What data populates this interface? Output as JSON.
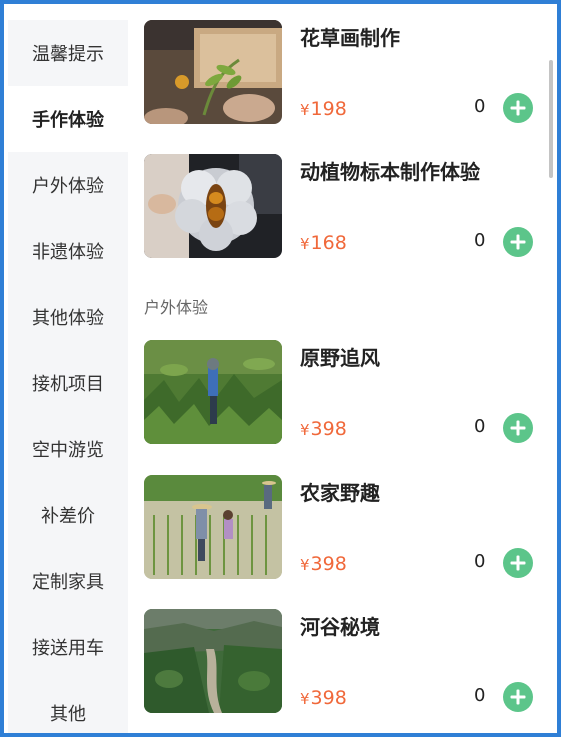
{
  "sidebar": {
    "items": [
      {
        "label": "温馨提示"
      },
      {
        "label": "手作体验",
        "active": true
      },
      {
        "label": "户外体验"
      },
      {
        "label": "非遗体验"
      },
      {
        "label": "其他体验"
      },
      {
        "label": "接机项目"
      },
      {
        "label": "空中游览"
      },
      {
        "label": "补差价"
      },
      {
        "label": "定制家具"
      },
      {
        "label": "接送用车"
      },
      {
        "label": "其他"
      }
    ]
  },
  "currency": "¥",
  "handcraft_items": [
    {
      "name": "花草画制作",
      "price": "198",
      "quantity": "0",
      "image": "pressed-flower-craft-photo"
    },
    {
      "name": "动植物标本制作体验",
      "price": "168",
      "quantity": "0",
      "image": "insect-specimen-photo"
    }
  ],
  "outdoor_section": {
    "title": "户外体验",
    "items": [
      {
        "name": "原野追风",
        "price": "398",
        "quantity": "0",
        "image": "fern-field-hiker-photo"
      },
      {
        "name": "农家野趣",
        "price": "398",
        "quantity": "0",
        "image": "rice-paddy-farmers-photo"
      },
      {
        "name": "河谷秘境",
        "price": "398",
        "quantity": "0",
        "image": "river-valley-photo"
      }
    ]
  },
  "colors": {
    "accent_border": "#2f7fd6",
    "price": "#f0683a",
    "add_button": "#5cc58a",
    "sidebar_bg": "#f5f6f8"
  }
}
